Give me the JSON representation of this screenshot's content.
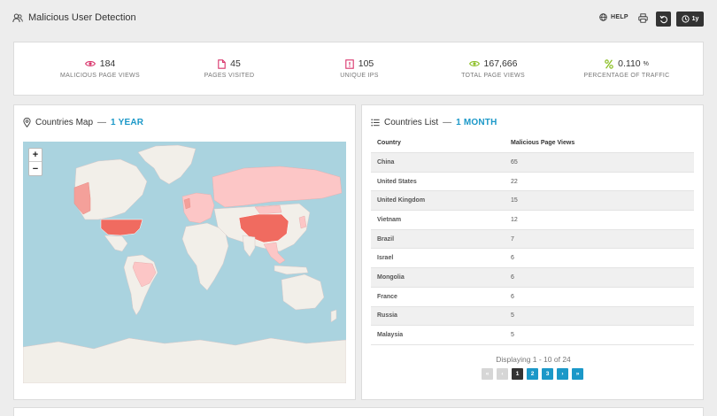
{
  "header": {
    "title": "Malicious User Detection",
    "help_label": "HELP",
    "period_label": "1y"
  },
  "stats": [
    {
      "value": "184",
      "unit": "",
      "label": "MALICIOUS PAGE VIEWS",
      "icon": "eye-icon",
      "color": "#d9346b"
    },
    {
      "value": "45",
      "unit": "",
      "label": "PAGES VISITED",
      "icon": "document-icon",
      "color": "#d9346b"
    },
    {
      "value": "105",
      "unit": "",
      "label": "UNIQUE IPS",
      "icon": "ip-icon",
      "color": "#d9346b"
    },
    {
      "value": "167,666",
      "unit": "",
      "label": "TOTAL PAGE VIEWS",
      "icon": "eye-icon",
      "color": "#8cbf26"
    },
    {
      "value": "0.110",
      "unit": "%",
      "label": "PERCENTAGE OF TRAFFIC",
      "icon": "percent-icon",
      "color": "#8cbf26"
    }
  ],
  "map_panel": {
    "title": "Countries Map",
    "dash": "—",
    "period": "1 YEAR",
    "zoom_in": "+",
    "zoom_out": "−"
  },
  "list_panel": {
    "title": "Countries List",
    "dash": "—",
    "period": "1 MONTH",
    "columns": [
      "Country",
      "Malicious Page Views"
    ],
    "rows": [
      {
        "country": "China",
        "views": "65"
      },
      {
        "country": "United States",
        "views": "22"
      },
      {
        "country": "United Kingdom",
        "views": "15"
      },
      {
        "country": "Vietnam",
        "views": "12"
      },
      {
        "country": "Brazil",
        "views": "7"
      },
      {
        "country": "Israel",
        "views": "6"
      },
      {
        "country": "Mongolia",
        "views": "6"
      },
      {
        "country": "France",
        "views": "6"
      },
      {
        "country": "Russia",
        "views": "5"
      },
      {
        "country": "Malaysia",
        "views": "5"
      }
    ],
    "display_text": "Displaying 1 - 10 of 24",
    "pager": {
      "first": "«",
      "prev": "‹",
      "pages": [
        "1",
        "2",
        "3"
      ],
      "next": "›",
      "last": "»"
    }
  },
  "colors": {
    "accent": "#1b98c8",
    "alert": "#d9346b",
    "ok": "#8cbf26",
    "map_high": "#f06b60",
    "map_mid": "#f4a09a",
    "map_low": "#fcc6c6",
    "ocean": "#aad3df",
    "land": "#f2efe9"
  }
}
